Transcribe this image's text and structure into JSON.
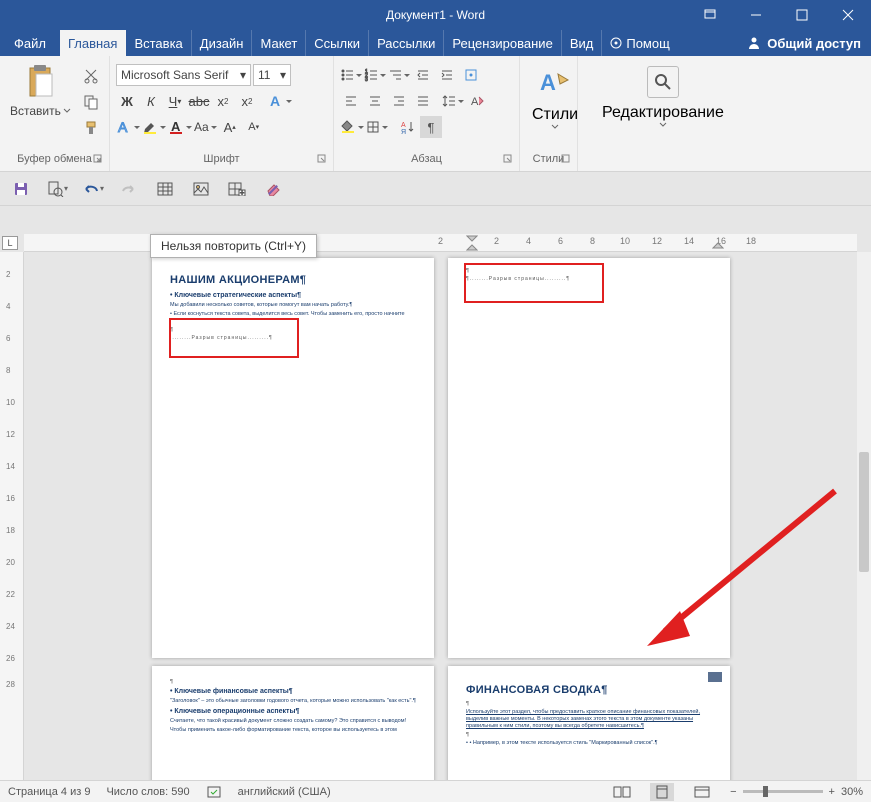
{
  "title": "Документ1 - Word",
  "menu": {
    "file": "Файл",
    "home": "Главная",
    "insert": "Вставка",
    "design": "Дизайн",
    "layout": "Макет",
    "refs": "Ссылки",
    "mail": "Рассылки",
    "review": "Рецензирование",
    "view": "Вид",
    "help": "Помощ",
    "share": "Общий доступ"
  },
  "ribbon": {
    "clipboard": {
      "label": "Буфер обмена",
      "paste": "Вставить"
    },
    "font": {
      "label": "Шрифт",
      "name": "Microsoft Sans Serif",
      "size": "11"
    },
    "paragraph": {
      "label": "Абзац"
    },
    "styles": {
      "label": "Стили",
      "btn": "Стили"
    },
    "editing": {
      "label": "Редактирование"
    }
  },
  "tooltip": "Нельзя повторить (Ctrl+Y)",
  "hruler": {
    "left": "2",
    "nums": [
      "2",
      "4",
      "6",
      "8",
      "10",
      "12",
      "14",
      "16",
      "18"
    ]
  },
  "vruler": [
    "2",
    "4",
    "6",
    "8",
    "10",
    "12",
    "14",
    "16",
    "18",
    "20",
    "22",
    "24",
    "26",
    "28"
  ],
  "lbox": "L",
  "doc": {
    "p1": {
      "h": "НАШИМ АКЦИОНЕРАМ¶",
      "sub": "• Ключевые стратегические аспекты¶",
      "l1": "Мы добавили несколько советов, которые помогут вам начать работу.¶",
      "l2": "• Если коснуться текста совета, выделится весь совет. Чтобы заменить его, просто начните",
      "break": "¶",
      "breaktext": ".........Разрыв страницы.........¶"
    },
    "p2": {
      "break": "¶",
      "breaktext": "¶........Разрыв страницы.........¶"
    },
    "p3": {
      "h1": "• Ключевые финансовые аспекты¶",
      "l1": "\"Заголовок\" – это обычные заголовки годового отчета, которые можно использовать \"как есть\".¶",
      "h2": "• Ключевые операционные аспекты¶",
      "l2": "Считаете, что такой красивый документ сложно создать самому? Это справится с выводом!",
      "l3": "Чтобы применить какое-либо форматирование текста, которое вы используетесь в этом"
    },
    "p4": {
      "h": "ФИНАНСОВАЯ СВОДКА¶",
      "l1": "Используйте этот раздел, чтобы предоставить краткое описание финансовых показателей, выделив важные моменты. В некоторых заменах этого текста в этом документе указаны правильным к ним стили, поэтому вы всегда обретете нависшитесь.¶",
      "l2": "• • Например, в этом тексте используется стиль \"Маркированный список\".¶"
    }
  },
  "status": {
    "page": "Страница 4 из 9",
    "words": "Число слов: 590",
    "lang": "английский (США)",
    "zoom": "30%"
  }
}
